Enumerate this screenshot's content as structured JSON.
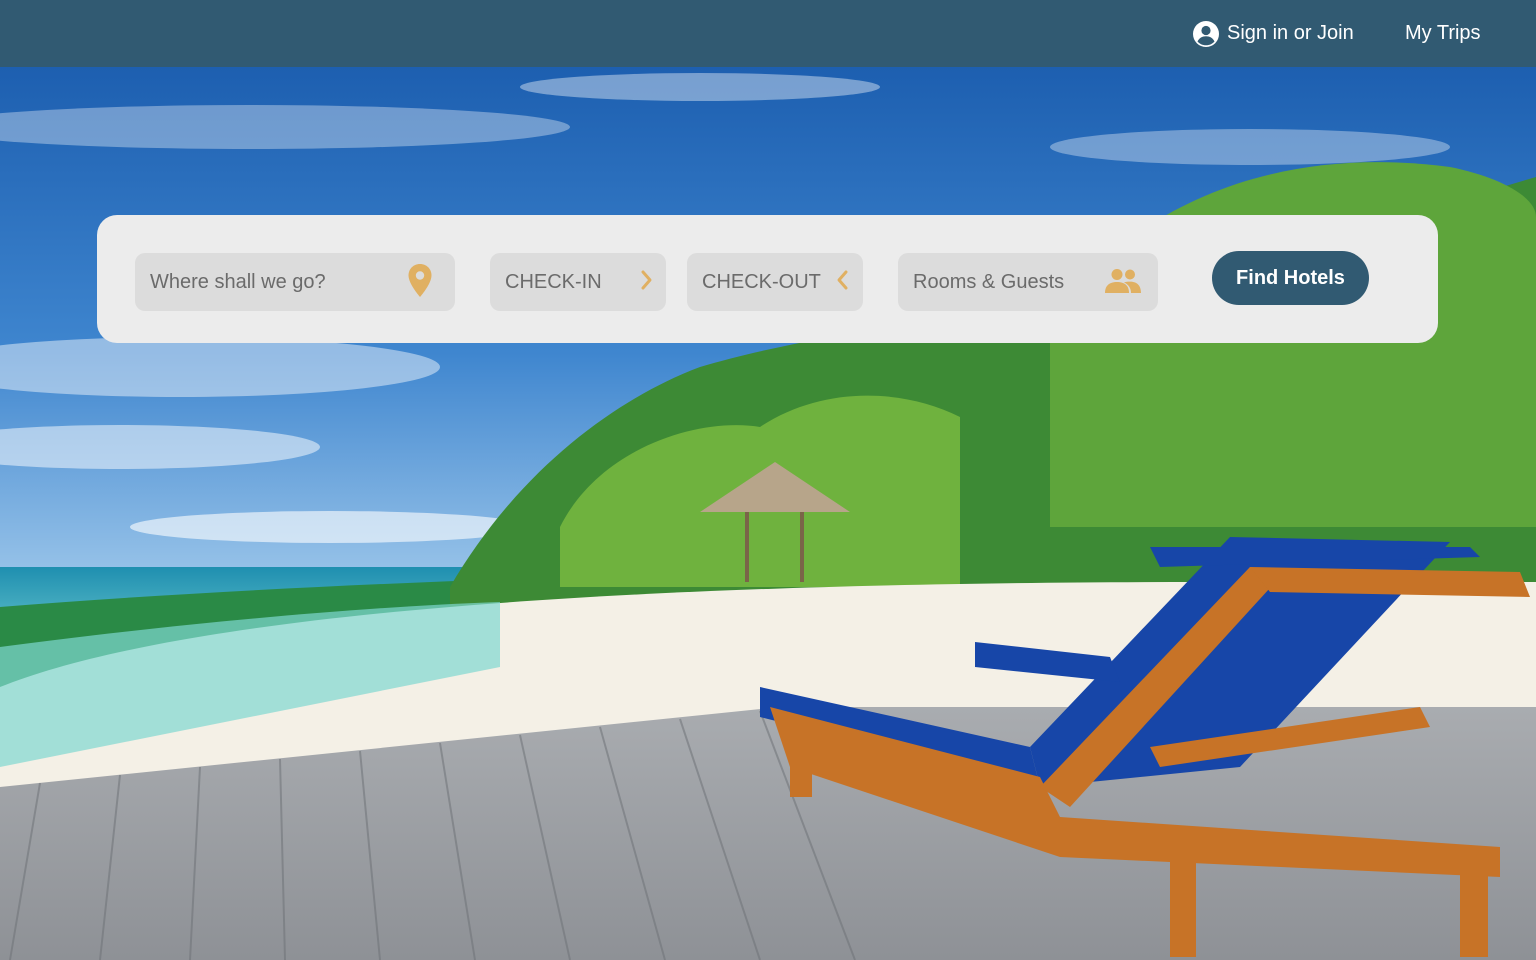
{
  "nav": {
    "signin_label": "Sign in or Join",
    "trips_label": "My Trips"
  },
  "search": {
    "destination_placeholder": "Where shall we go?",
    "checkin_label": "CHECK-IN",
    "checkout_label": "CHECK-OUT",
    "rooms_label": "Rooms & Guests",
    "find_label": "Find Hotels"
  },
  "colors": {
    "header": "#315a72",
    "accent_icon": "#e0b062",
    "card": "#ececec",
    "field": "#dcdcdc"
  },
  "icons": {
    "account": "account-circle-icon",
    "location": "map-pin-icon",
    "checkin": "chevron-right-icon",
    "checkout": "chevron-left-icon",
    "guests": "people-icon"
  }
}
